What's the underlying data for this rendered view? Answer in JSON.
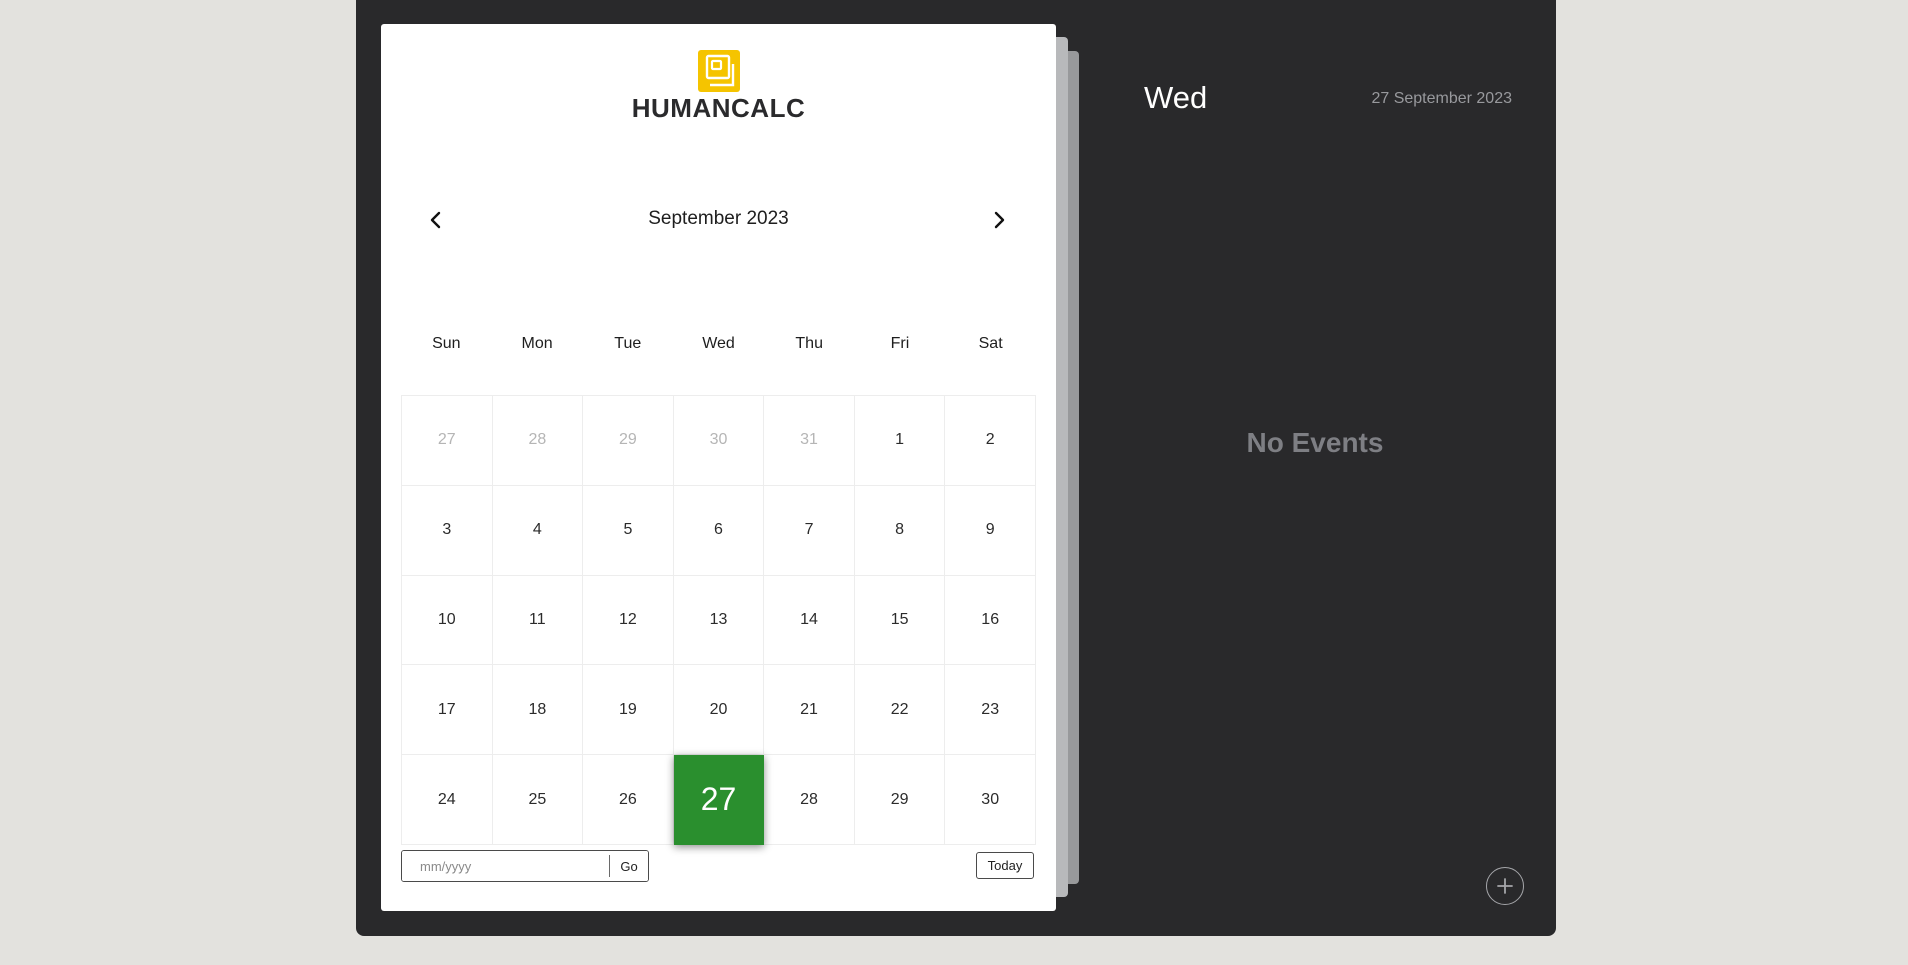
{
  "brand": {
    "name": "HUMANCALC",
    "logo_color": "#f5c400"
  },
  "calendar": {
    "month_title": "September 2023",
    "prev_icon": "chevron-left-icon",
    "next_icon": "chevron-right-icon",
    "weekdays": [
      "Sun",
      "Mon",
      "Tue",
      "Wed",
      "Thu",
      "Fri",
      "Sat"
    ],
    "weeks": [
      [
        "27",
        "28",
        "29",
        "30",
        "31",
        "1",
        "2"
      ],
      [
        "3",
        "4",
        "5",
        "6",
        "7",
        "8",
        "9"
      ],
      [
        "10",
        "11",
        "12",
        "13",
        "14",
        "15",
        "16"
      ],
      [
        "17",
        "18",
        "19",
        "20",
        "21",
        "22",
        "23"
      ],
      [
        "24",
        "25",
        "26",
        "27",
        "28",
        "29",
        "30"
      ]
    ],
    "selected_color": "#2a8f2e"
  },
  "goto": {
    "placeholder": "mm/yyyy",
    "go_label": "Go",
    "today_label": "Today"
  },
  "events": {
    "day_name": "Wed",
    "full_date": "27 September 2023",
    "empty_text": "No Events",
    "add_icon": "plus-icon"
  }
}
